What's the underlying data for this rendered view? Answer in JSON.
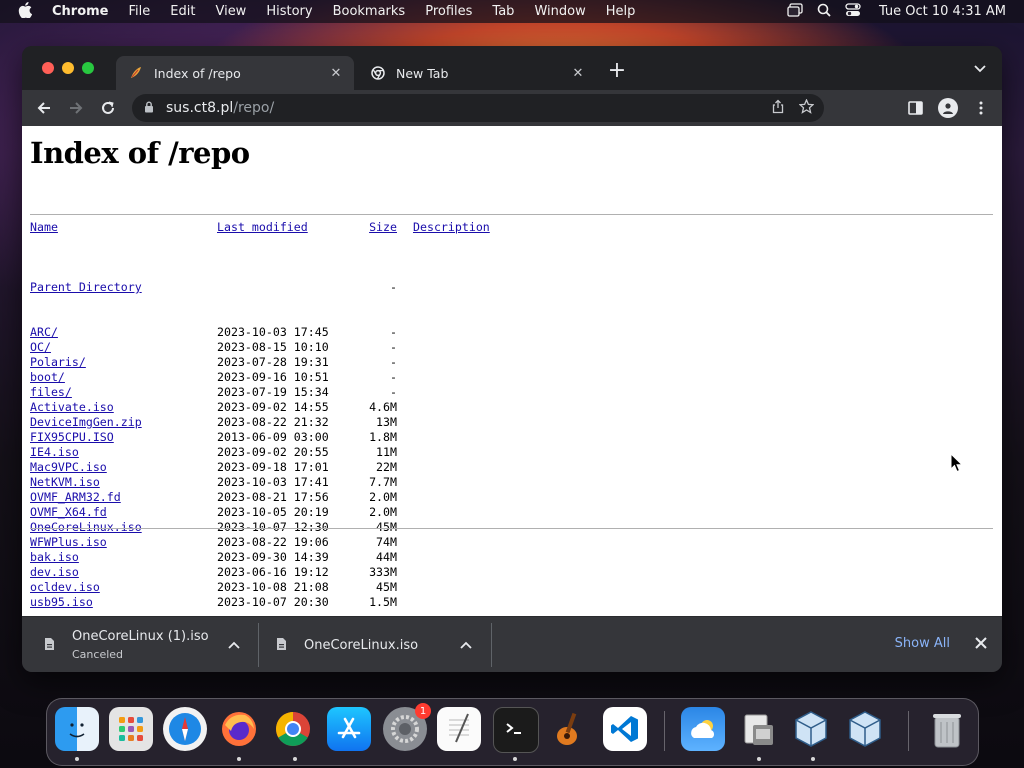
{
  "menubar": {
    "app": "Chrome",
    "items": [
      "File",
      "Edit",
      "View",
      "History",
      "Bookmarks",
      "Profiles",
      "Tab",
      "Window",
      "Help"
    ],
    "clock": "Tue Oct 10  4:31 AM"
  },
  "tabs": [
    {
      "title": "Index of /repo",
      "active": true
    },
    {
      "title": "New Tab",
      "active": false
    }
  ],
  "omnibox": {
    "host": "sus.ct8.pl",
    "path": "/repo/"
  },
  "page": {
    "heading": "Index of /repo",
    "columns": {
      "name": "Name",
      "modified": "Last modified",
      "size": "Size",
      "description": "Description"
    },
    "parent": {
      "name": "Parent Directory",
      "size": "-"
    },
    "entries": [
      {
        "name": "ARC/",
        "modified": "2023-10-03 17:45",
        "size": "-"
      },
      {
        "name": "OC/",
        "modified": "2023-08-15 10:10",
        "size": "-"
      },
      {
        "name": "Polaris/",
        "modified": "2023-07-28 19:31",
        "size": "-"
      },
      {
        "name": "boot/",
        "modified": "2023-09-16 10:51",
        "size": "-"
      },
      {
        "name": "files/",
        "modified": "2023-07-19 15:34",
        "size": "-"
      },
      {
        "name": "Activate.iso",
        "modified": "2023-09-02 14:55",
        "size": "4.6M"
      },
      {
        "name": "DeviceImgGen.zip",
        "modified": "2023-08-22 21:32",
        "size": "13M"
      },
      {
        "name": "FIX95CPU.ISO",
        "modified": "2013-06-09 03:00",
        "size": "1.8M"
      },
      {
        "name": "IE4.iso",
        "modified": "2023-09-02 20:55",
        "size": "11M"
      },
      {
        "name": "Mac9VPC.iso",
        "modified": "2023-09-18 17:01",
        "size": "22M"
      },
      {
        "name": "NetKVM.iso",
        "modified": "2023-10-03 17:41",
        "size": "7.7M"
      },
      {
        "name": "OVMF_ARM32.fd",
        "modified": "2023-08-21 17:56",
        "size": "2.0M"
      },
      {
        "name": "OVMF_X64.fd",
        "modified": "2023-10-05 20:19",
        "size": "2.0M"
      },
      {
        "name": "OneCoreLinux.iso",
        "modified": "2023-10-07 12:30",
        "size": "45M"
      },
      {
        "name": "WFWPlus.iso",
        "modified": "2023-08-22 19:06",
        "size": "74M"
      },
      {
        "name": "bak.iso",
        "modified": "2023-09-30 14:39",
        "size": "44M"
      },
      {
        "name": "dev.iso",
        "modified": "2023-06-16 19:12",
        "size": "333M"
      },
      {
        "name": "ocldev.iso",
        "modified": "2023-10-08 21:08",
        "size": "45M"
      },
      {
        "name": "usb95.iso",
        "modified": "2023-10-07 20:30",
        "size": "1.5M"
      }
    ]
  },
  "downloads": {
    "items": [
      {
        "filename": "OneCoreLinux (1).iso",
        "status": "Canceled"
      },
      {
        "filename": "OneCoreLinux.iso",
        "status": ""
      }
    ],
    "show_all": "Show All"
  },
  "dock": {
    "settings_badge": "1",
    "apps": [
      "finder-icon",
      "launchpad-icon",
      "safari-icon",
      "firefox-icon",
      "chrome-icon",
      "app-store-icon",
      "system-settings-icon",
      "textedit-icon",
      "terminal-icon",
      "garageband-icon",
      "vscode-icon",
      "weather-icon",
      "preview-icon",
      "virtualbox-icon",
      "virtualbox-icon",
      "trash-icon"
    ]
  },
  "colors": {
    "link": "#1a0dab",
    "show_all": "#8ab4f8",
    "chrome_dark": "#35363a"
  }
}
